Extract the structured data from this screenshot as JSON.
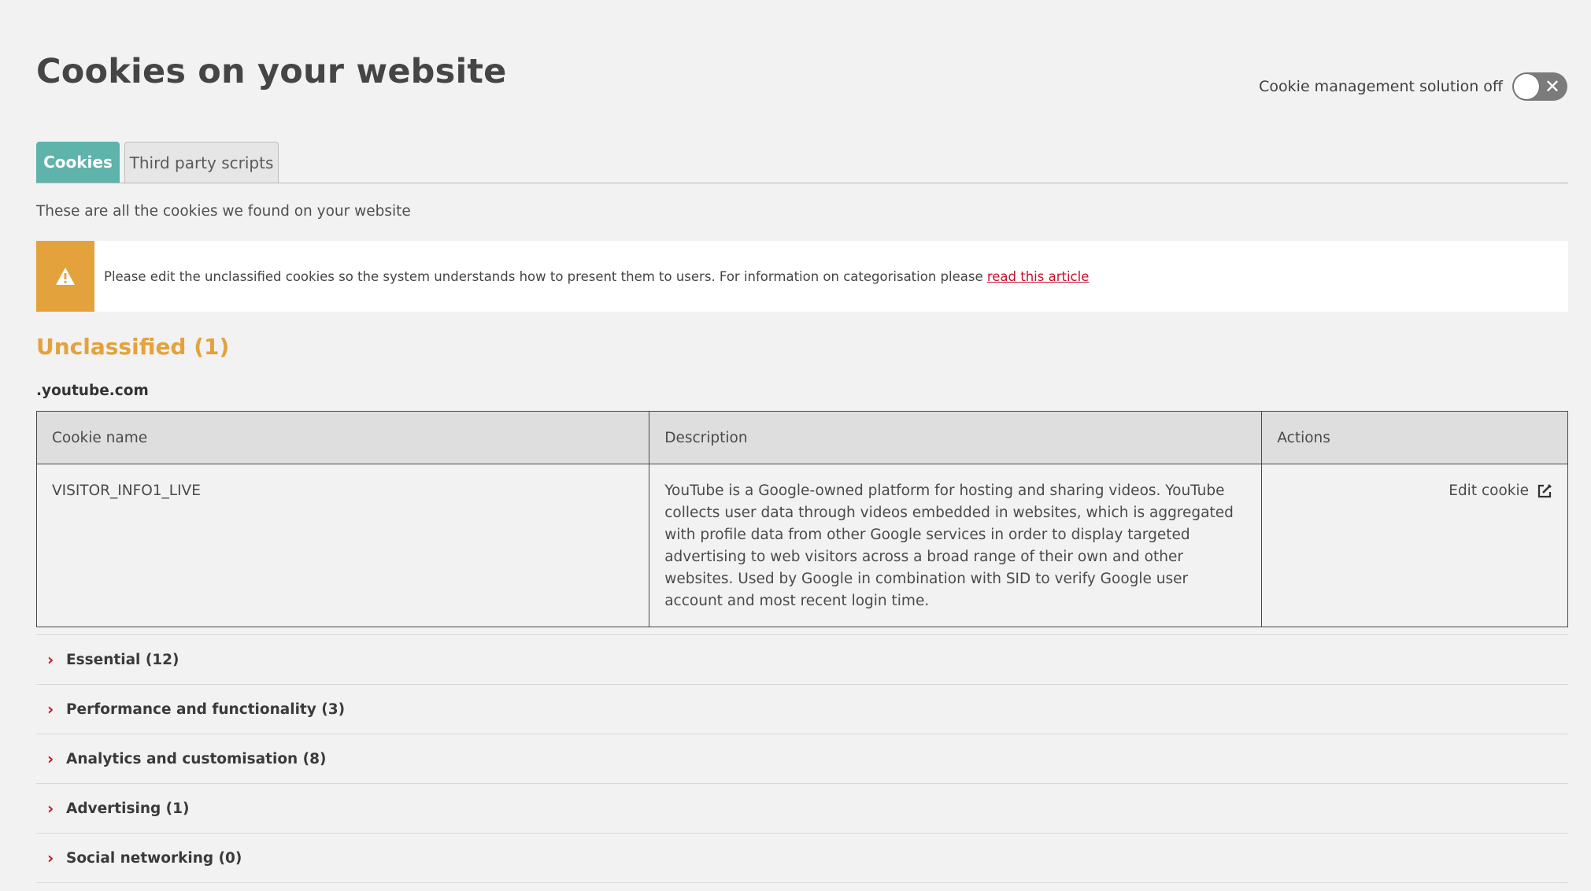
{
  "page": {
    "title": "Cookies on your website"
  },
  "cms_toggle": {
    "label": "Cookie management solution off",
    "state": "off"
  },
  "tabs": [
    {
      "label": "Cookies",
      "active": true
    },
    {
      "label": "Third party scripts",
      "active": false
    }
  ],
  "intro": "These are all the cookies we found on your website",
  "alert": {
    "text": "Please edit the unclassified cookies so the system understands how to present them to users. For information on categorisation please ",
    "link_label": "read this article",
    "icon": "warning-icon",
    "color": "#e3a23c"
  },
  "unclassified": {
    "heading": "Unclassified (1)",
    "domain": ".youtube.com",
    "table": {
      "headers": [
        "Cookie name",
        "Description",
        "Actions"
      ],
      "rows": [
        {
          "name": "VISITOR_INFO1_LIVE",
          "description": "YouTube is a Google-owned platform for hosting and sharing videos. YouTube collects user data through videos embedded in websites, which is aggregated with profile data from other Google services in order to display targeted advertising to web visitors across a broad range of their own and other websites. Used by Google in combination with SID to verify Google user account and most recent login time.",
          "action_label": "Edit cookie"
        }
      ]
    }
  },
  "categories": [
    {
      "label": "Essential (12)"
    },
    {
      "label": "Performance and functionality (3)"
    },
    {
      "label": "Analytics and customisation (8)"
    },
    {
      "label": "Advertising (1)"
    },
    {
      "label": "Social networking (0)"
    }
  ],
  "colors": {
    "accent_teal": "#5eb3ab",
    "warning_orange": "#e3a23c",
    "link_red": "#c8102e"
  }
}
